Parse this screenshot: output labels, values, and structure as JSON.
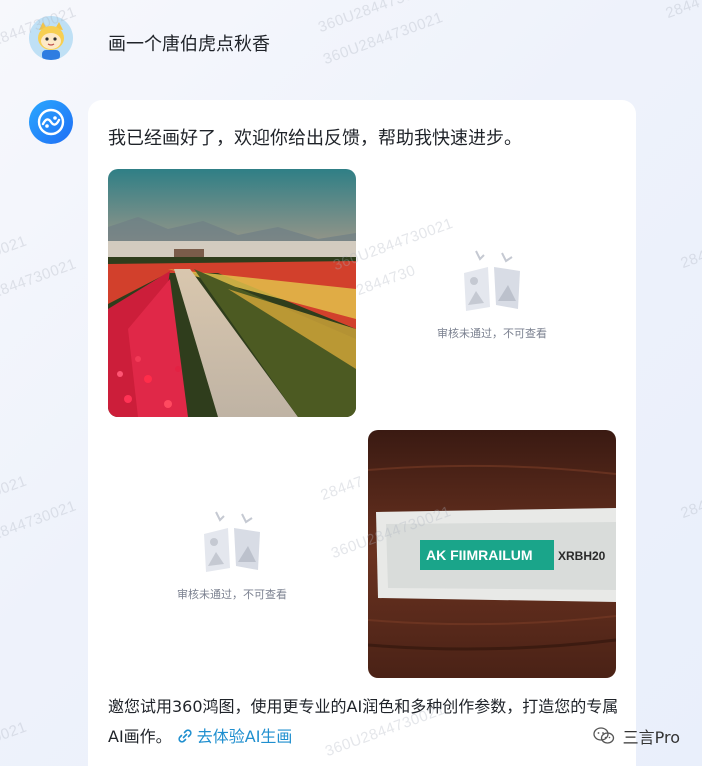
{
  "user_message": {
    "text": "画一个唐伯虎点秋香"
  },
  "bot_message": {
    "intro": "我已经画好了，欢迎你给出反馈，帮助我快速进步。",
    "images": [
      {
        "status": "ok",
        "subject": "flower-field-path-photo"
      },
      {
        "status": "blocked",
        "label": "审核未通过，不可查看"
      },
      {
        "status": "blocked",
        "label": "审核未通过，不可查看"
      },
      {
        "status": "ok",
        "subject": "nameplate-photo",
        "sign_text": "AK FIIMRAILUM",
        "sign_code": "XRBH20"
      }
    ],
    "footer_text": "邀您试用360鸿图，使用更专业的AI润色和多种创作参数，打造您的专属AI画作。",
    "footer_link": "去体验AI生画"
  },
  "watermark": {
    "text": "360U2844730021",
    "fragments": [
      "2844730021",
      "0021",
      "28447",
      "360U2844730021",
      "2844730"
    ]
  },
  "brand": {
    "label": "三言Pro"
  },
  "colors": {
    "link": "#1f8fcf",
    "bot_avatar": "#1f6ef5",
    "sign_green": "#1aa58a"
  }
}
